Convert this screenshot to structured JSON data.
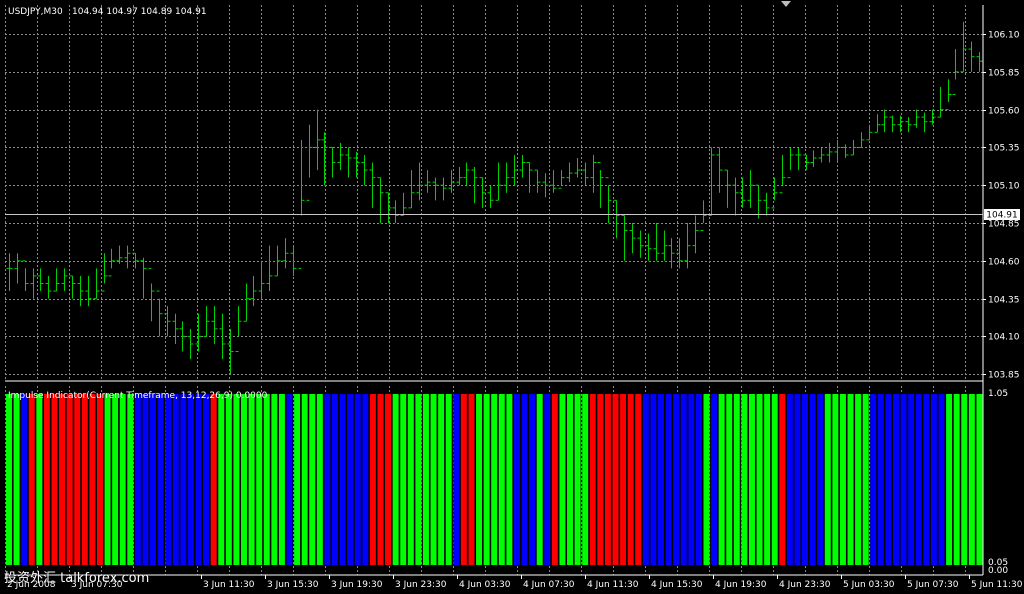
{
  "header": {
    "symbol": "USDJPY,M30",
    "ohlc": "104.94 104.97 104.89 104.91"
  },
  "indicator": {
    "label": "Impulse Indicator(Current Timeframe, 13,12,26,9) 0.0000"
  },
  "current_price": "104.91",
  "watermark": "投资外汇 talkforex.com",
  "colors": {
    "background": "#000000",
    "grid": "#8a8a8a",
    "candle": "#00d000",
    "bull": "#00ff00",
    "bear": "#ff0000",
    "neutral": "#0000ff"
  },
  "chart_data": [
    {
      "type": "ohlc",
      "symbol": "USDJPY",
      "timeframe": "M30",
      "y_ticks": [
        "106.10",
        "105.85",
        "105.60",
        "105.35",
        "105.10",
        "104.85",
        "104.60",
        "104.35",
        "104.10",
        "103.85"
      ],
      "x_ticks": [
        "2 Jun 2008",
        "3 Jun 07:30",
        "3 Jun 11:30",
        "3 Jun 15:30",
        "3 Jun 19:30",
        "3 Jun 23:30",
        "4 Jun 03:30",
        "4 Jun 07:30",
        "4 Jun 11:30",
        "4 Jun 15:30",
        "4 Jun 19:30",
        "4 Jun 23:30",
        "5 Jun 03:30",
        "5 Jun 07:30",
        "5 Jun 11:30"
      ],
      "ylim": [
        103.82,
        106.18
      ],
      "close": [
        104.55,
        104.6,
        104.45,
        104.5,
        104.45,
        104.4,
        104.45,
        104.5,
        104.45,
        104.4,
        104.35,
        104.4,
        104.5,
        104.6,
        104.62,
        104.65,
        104.6,
        104.55,
        104.4,
        104.25,
        104.2,
        104.15,
        104.1,
        104.05,
        104.1,
        104.2,
        104.15,
        104.05,
        104.0,
        104.2,
        104.35,
        104.4,
        104.45,
        104.5,
        104.6,
        104.65,
        104.55,
        105.0,
        105.35,
        105.4,
        105.35,
        105.25,
        105.3,
        105.28,
        105.25,
        105.2,
        105.15,
        105.05,
        104.95,
        104.9,
        104.95,
        105.05,
        105.1,
        105.12,
        105.1,
        105.08,
        105.12,
        105.15,
        105.2,
        105.15,
        105.05,
        105.0,
        105.1,
        105.15,
        105.2,
        105.25,
        105.2,
        105.12,
        105.1,
        105.08,
        105.15,
        105.18,
        105.2,
        105.15,
        105.25,
        105.15,
        105.0,
        104.9,
        104.8,
        104.75,
        104.7,
        104.68,
        104.65,
        104.7,
        104.65,
        104.6,
        104.7,
        104.8,
        104.9,
        105.3,
        105.2,
        105.1,
        105.05,
        105.0,
        105.1,
        105.0,
        104.95,
        105.05,
        105.15,
        105.3,
        105.3,
        105.25,
        105.28,
        105.3,
        105.32,
        105.35,
        105.3,
        105.35,
        105.4,
        105.45,
        105.5,
        105.55,
        105.5,
        105.52,
        105.5,
        105.55,
        105.52,
        105.55,
        105.6,
        105.7,
        105.85,
        106.0,
        105.95,
        105.92
      ],
      "high": [
        104.65,
        104.65,
        104.55,
        104.55,
        104.55,
        104.5,
        104.55,
        104.55,
        104.5,
        104.5,
        104.5,
        104.55,
        104.65,
        104.68,
        104.7,
        104.7,
        104.65,
        104.62,
        104.45,
        104.35,
        104.3,
        104.25,
        104.2,
        104.15,
        104.25,
        104.3,
        104.3,
        104.25,
        104.15,
        104.3,
        104.45,
        104.5,
        104.6,
        104.7,
        104.7,
        104.75,
        104.7,
        105.4,
        105.5,
        105.6,
        105.45,
        105.35,
        105.38,
        105.35,
        105.32,
        105.3,
        105.25,
        105.15,
        105.05,
        105.0,
        105.05,
        105.2,
        105.25,
        105.2,
        105.15,
        105.15,
        105.2,
        105.22,
        105.25,
        105.22,
        105.15,
        105.1,
        105.25,
        105.25,
        105.3,
        105.3,
        105.25,
        105.2,
        105.18,
        105.2,
        105.2,
        105.25,
        105.28,
        105.25,
        105.3,
        105.2,
        105.1,
        105.0,
        104.9,
        104.85,
        104.8,
        104.78,
        104.85,
        104.8,
        104.75,
        104.75,
        104.85,
        104.9,
        105.0,
        105.35,
        105.35,
        105.2,
        105.15,
        105.15,
        105.2,
        105.1,
        105.05,
        105.15,
        105.3,
        105.35,
        105.35,
        105.3,
        105.33,
        105.35,
        105.38,
        105.4,
        105.37,
        105.4,
        105.45,
        105.5,
        105.57,
        105.6,
        105.56,
        105.56,
        105.55,
        105.6,
        105.58,
        105.6,
        105.75,
        105.8,
        106.0,
        106.18,
        106.05,
        105.98
      ],
      "low": [
        104.4,
        104.45,
        104.4,
        104.35,
        104.4,
        104.35,
        104.4,
        104.4,
        104.35,
        104.3,
        104.3,
        104.35,
        104.45,
        104.55,
        104.58,
        104.55,
        104.55,
        104.35,
        104.2,
        104.1,
        104.1,
        104.05,
        104.0,
        103.95,
        104.0,
        104.1,
        104.05,
        103.95,
        103.85,
        104.1,
        104.2,
        104.3,
        104.35,
        104.4,
        104.5,
        104.55,
        104.5,
        104.9,
        105.15,
        105.2,
        105.1,
        105.15,
        105.2,
        105.15,
        105.15,
        105.1,
        104.95,
        104.85,
        104.85,
        104.85,
        104.9,
        104.95,
        105.0,
        105.05,
        105.0,
        105.0,
        105.05,
        105.1,
        105.1,
        104.98,
        104.95,
        104.95,
        105.0,
        105.05,
        105.1,
        105.15,
        105.05,
        105.05,
        105.02,
        105.05,
        105.1,
        105.12,
        105.15,
        105.1,
        105.05,
        104.95,
        104.85,
        104.75,
        104.6,
        104.65,
        104.62,
        104.6,
        104.6,
        104.6,
        104.55,
        104.55,
        104.55,
        104.65,
        104.85,
        104.9,
        105.05,
        104.95,
        104.9,
        104.95,
        104.95,
        104.88,
        104.9,
        105.0,
        105.1,
        105.2,
        105.2,
        105.2,
        105.22,
        105.25,
        105.25,
        105.25,
        105.28,
        105.3,
        105.35,
        105.4,
        105.45,
        105.45,
        105.45,
        105.45,
        105.45,
        105.48,
        105.45,
        105.5,
        105.55,
        105.65,
        105.8,
        105.85,
        105.85,
        105.85
      ]
    },
    {
      "type": "bar",
      "name": "Impulse Indicator",
      "ylim": [
        0,
        1.05
      ],
      "y_ticks": [
        "1.05",
        "0.05",
        "0.00"
      ],
      "legend": [
        "bull",
        "bear",
        "neutral"
      ],
      "states": [
        "bull",
        "bull",
        "neutral",
        "bear",
        "bull",
        "bear",
        "bear",
        "bear",
        "bear",
        "bear",
        "bear",
        "bear",
        "bear",
        "bull",
        "bull",
        "bull",
        "bull",
        "neutral",
        "neutral",
        "neutral",
        "neutral",
        "neutral",
        "neutral",
        "neutral",
        "neutral",
        "neutral",
        "neutral",
        "bear",
        "bull",
        "bull",
        "bull",
        "bull",
        "bull",
        "bull",
        "bull",
        "bull",
        "bull",
        "neutral",
        "bull",
        "bull",
        "bull",
        "bull",
        "neutral",
        "neutral",
        "neutral",
        "neutral",
        "neutral",
        "neutral",
        "bear",
        "bear",
        "bear",
        "bull",
        "bull",
        "bull",
        "bull",
        "bull",
        "bull",
        "bull",
        "bull",
        "neutral",
        "bear",
        "bear",
        "bull",
        "bull",
        "bull",
        "bull",
        "bull",
        "neutral",
        "neutral",
        "neutral",
        "bull",
        "neutral",
        "bear",
        "bull",
        "bull",
        "bull",
        "bull",
        "bear",
        "bear",
        "bear",
        "bear",
        "bear",
        "bear",
        "bear",
        "neutral",
        "neutral",
        "neutral",
        "neutral",
        "neutral",
        "neutral",
        "neutral",
        "neutral",
        "bull",
        "neutral",
        "bull",
        "bull",
        "bull",
        "bull",
        "bull",
        "bull",
        "bull",
        "bull",
        "bear",
        "neutral",
        "neutral",
        "neutral",
        "neutral",
        "neutral",
        "bull",
        "bull",
        "bull",
        "bull",
        "bull",
        "bull",
        "neutral",
        "neutral",
        "neutral",
        "neutral",
        "neutral",
        "neutral",
        "neutral",
        "neutral",
        "neutral",
        "neutral",
        "bull",
        "bull",
        "bull",
        "bull",
        "bull"
      ]
    }
  ]
}
